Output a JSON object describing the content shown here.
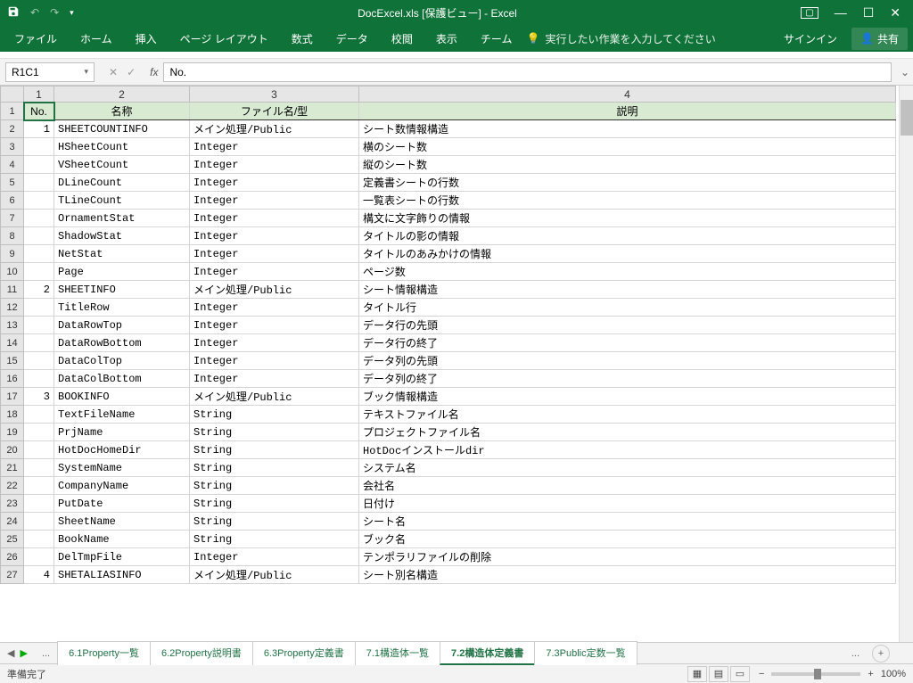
{
  "titlebar": {
    "title": "DocExcel.xls [保護ビュー] - Excel"
  },
  "ribbon": {
    "tabs": [
      "ファイル",
      "ホーム",
      "挿入",
      "ページ レイアウト",
      "数式",
      "データ",
      "校閲",
      "表示",
      "チーム"
    ],
    "tellme": "実行したい作業を入力してください",
    "signin": "サインイン",
    "share": "共有"
  },
  "formula": {
    "namebox": "R1C1",
    "input": "No."
  },
  "colhdrs": [
    "1",
    "2",
    "3",
    "4"
  ],
  "headers": {
    "no": "No.",
    "name": "名称",
    "file": "ファイル名/型",
    "desc": "説明"
  },
  "rows": [
    {
      "r": "1",
      "isHeader": true
    },
    {
      "r": "2",
      "no": "1",
      "name": "SHEETCOUNTINFO",
      "file": "メイン処理/Public",
      "desc": "シート数情報構造"
    },
    {
      "r": "3",
      "name": "HSheetCount",
      "file": "Integer",
      "desc": "横のシート数"
    },
    {
      "r": "4",
      "name": "VSheetCount",
      "file": "Integer",
      "desc": "縦のシート数"
    },
    {
      "r": "5",
      "name": "DLineCount",
      "file": "Integer",
      "desc": "定義書シートの行数"
    },
    {
      "r": "6",
      "name": "TLineCount",
      "file": "Integer",
      "desc": "一覧表シートの行数"
    },
    {
      "r": "7",
      "name": "OrnamentStat",
      "file": "Integer",
      "desc": "構文に文字飾りの情報"
    },
    {
      "r": "8",
      "name": "ShadowStat",
      "file": "Integer",
      "desc": "タイトルの影の情報"
    },
    {
      "r": "9",
      "name": "NetStat",
      "file": "Integer",
      "desc": "タイトルのあみかけの情報"
    },
    {
      "r": "10",
      "name": "Page",
      "file": "Integer",
      "desc": "ページ数"
    },
    {
      "r": "11",
      "no": "2",
      "name": "SHEETINFO",
      "file": "メイン処理/Public",
      "desc": "シート情報構造"
    },
    {
      "r": "12",
      "name": "TitleRow",
      "file": "Integer",
      "desc": "タイトル行"
    },
    {
      "r": "13",
      "name": "DataRowTop",
      "file": "Integer",
      "desc": "データ行の先頭"
    },
    {
      "r": "14",
      "name": "DataRowBottom",
      "file": "Integer",
      "desc": "データ行の終了"
    },
    {
      "r": "15",
      "name": "DataColTop",
      "file": "Integer",
      "desc": "データ列の先頭"
    },
    {
      "r": "16",
      "name": "DataColBottom",
      "file": "Integer",
      "desc": "データ列の終了"
    },
    {
      "r": "17",
      "no": "3",
      "name": "BOOKINFO",
      "file": "メイン処理/Public",
      "desc": "ブック情報構造"
    },
    {
      "r": "18",
      "name": "TextFileName",
      "file": "String",
      "desc": "テキストファイル名"
    },
    {
      "r": "19",
      "name": "PrjName",
      "file": "String",
      "desc": "プロジェクトファイル名"
    },
    {
      "r": "20",
      "name": "HotDocHomeDir",
      "file": "String",
      "desc": "HotDocインストールdir"
    },
    {
      "r": "21",
      "name": "SystemName",
      "file": "String",
      "desc": "システム名"
    },
    {
      "r": "22",
      "name": "CompanyName",
      "file": "String",
      "desc": "会社名"
    },
    {
      "r": "23",
      "name": "PutDate",
      "file": "String",
      "desc": "日付け"
    },
    {
      "r": "24",
      "name": "SheetName",
      "file": "String",
      "desc": "シート名"
    },
    {
      "r": "25",
      "name": "BookName",
      "file": "String",
      "desc": "ブック名"
    },
    {
      "r": "26",
      "name": "DelTmpFile",
      "file": "Integer",
      "desc": "テンポラリファイルの削除"
    },
    {
      "r": "27",
      "no": "4",
      "name": "SHETALIASINFO",
      "file": "メイン処理/Public",
      "desc": "シート別名構造"
    }
  ],
  "sheets": {
    "list": [
      "6.1Property一覧",
      "6.2Property説明書",
      "6.3Property定義書",
      "7.1構造体一覧",
      "7.2構造体定義書",
      "7.3Public定数一覧"
    ],
    "active": 4,
    "ellipsis": "...",
    "more": "..."
  },
  "status": {
    "ready": "準備完了",
    "zoom": "100%"
  }
}
